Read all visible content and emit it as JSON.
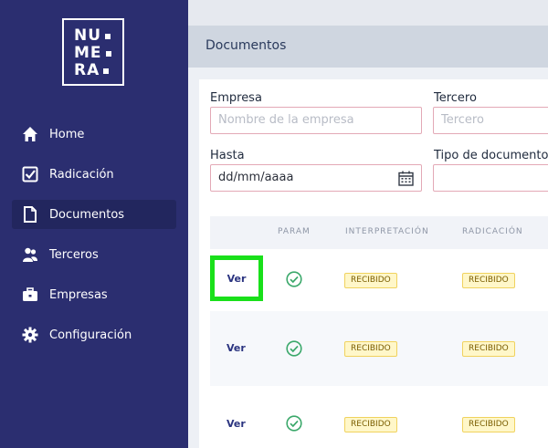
{
  "logo": {
    "rows": [
      "NU",
      "ME",
      "RA"
    ]
  },
  "sidebar": {
    "items": [
      {
        "label": "Home",
        "icon": "home-icon"
      },
      {
        "label": "Radicación",
        "icon": "checkbox-icon"
      },
      {
        "label": "Documentos",
        "icon": "document-icon",
        "active": true
      },
      {
        "label": "Terceros",
        "icon": "users-icon"
      },
      {
        "label": "Empresas",
        "icon": "briefcase-icon"
      },
      {
        "label": "Configuración",
        "icon": "gear-icon"
      }
    ]
  },
  "page": {
    "title": "Documentos"
  },
  "filters": {
    "empresa": {
      "label": "Empresa",
      "placeholder": "Nombre de la empresa"
    },
    "tercero": {
      "label": "Tercero",
      "placeholder": "Tercero"
    },
    "hasta": {
      "label": "Hasta",
      "value": "dd/mm/aaaa"
    },
    "tipo": {
      "label": "Tipo de documento",
      "value": ""
    }
  },
  "table": {
    "columns": [
      "",
      "PARAM",
      "INTERPRETACIÓN",
      "RADICACIÓN"
    ],
    "rows": [
      {
        "action": "Ver",
        "param": "ok",
        "interpretacion": "RECIBIDO",
        "radicacion": "RECIBIDO"
      },
      {
        "action": "Ver",
        "param": "ok",
        "interpretacion": "RECIBIDO",
        "radicacion": "RECIBIDO"
      },
      {
        "action": "Ver",
        "param": "ok",
        "interpretacion": "RECIBIDO",
        "radicacion": "RECIBIDO"
      }
    ]
  },
  "colors": {
    "sidebar": "#2b2e70",
    "check": "#3aa86a",
    "badge_bg": "#fff7c9",
    "highlight": "#19e01a"
  }
}
